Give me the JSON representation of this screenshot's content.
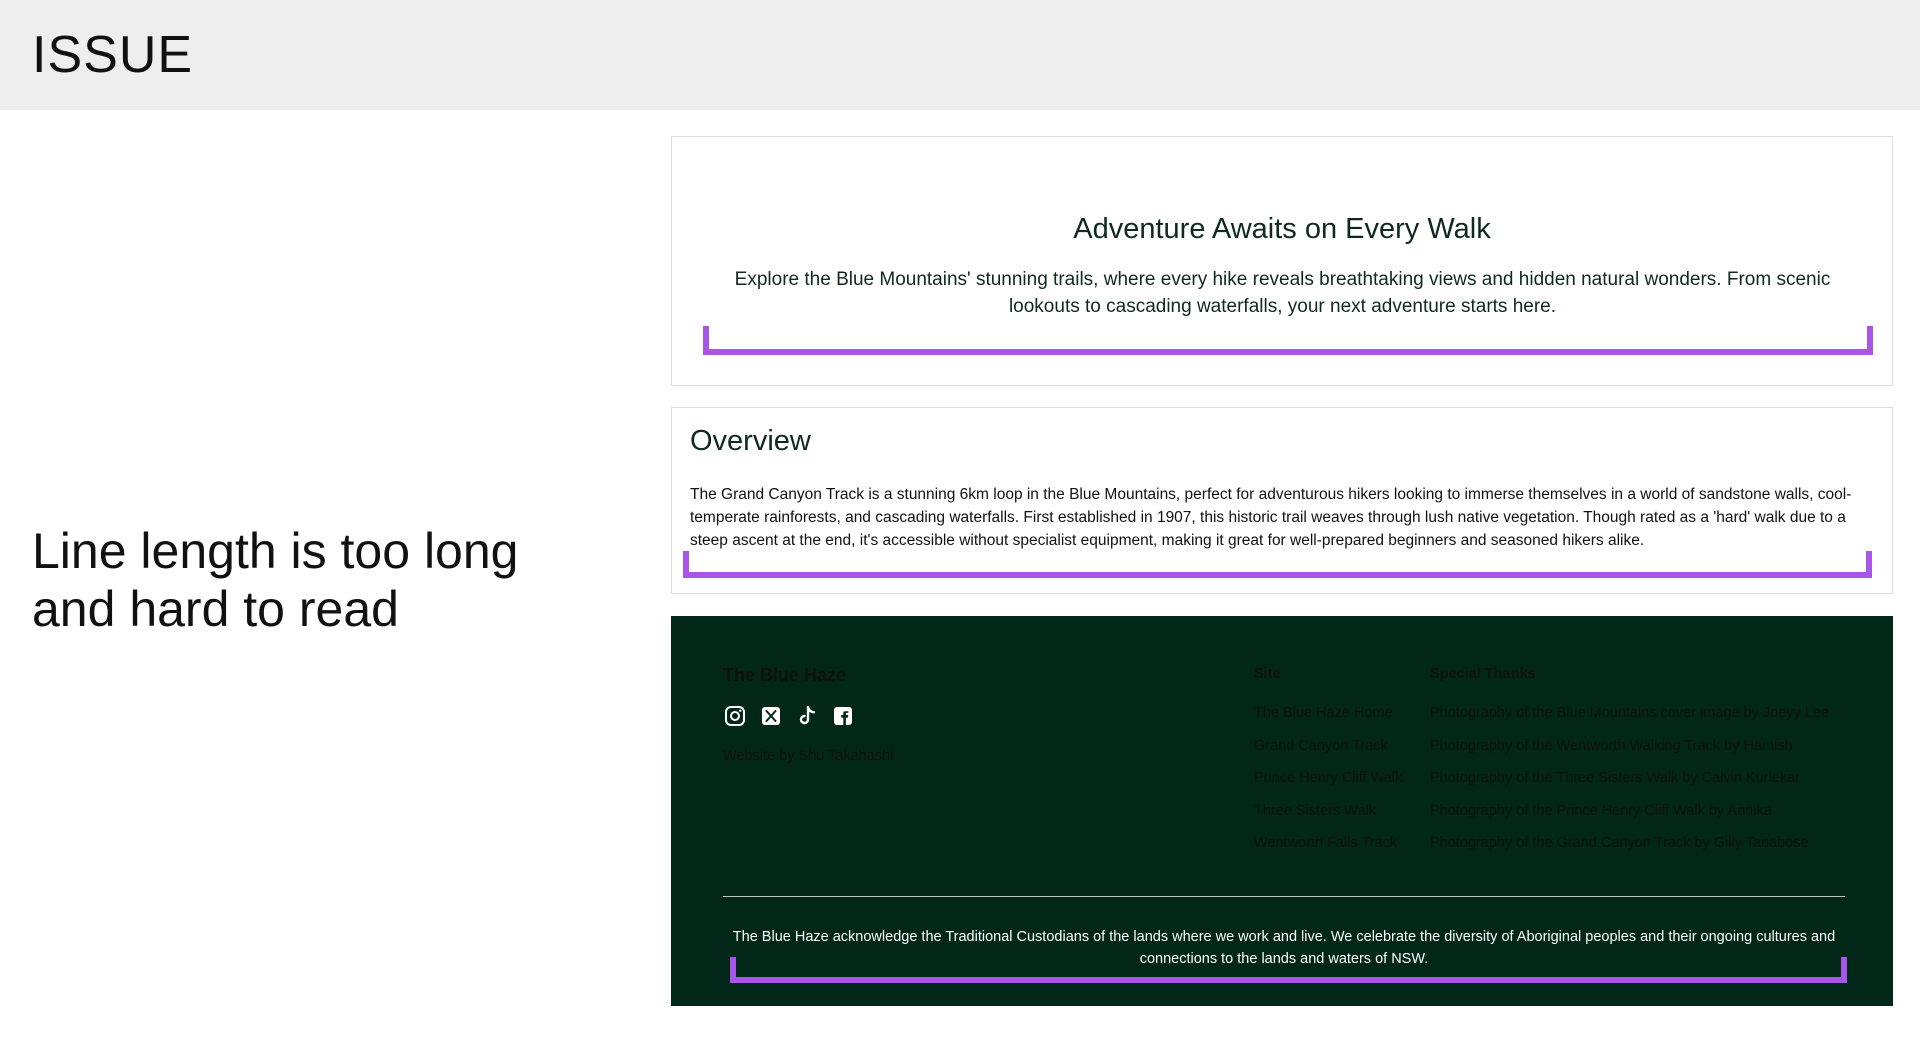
{
  "issue": {
    "title": "ISSUE",
    "note": "Line length is too long and hard to read"
  },
  "hero": {
    "heading": "Adventure Awaits on Every Walk",
    "text": "Explore the Blue Mountains' stunning trails, where every hike reveals breathtaking views and hidden natural wonders. From scenic lookouts to cascading waterfalls, your next adventure starts here."
  },
  "overview": {
    "heading": "Overview",
    "text": "The Grand Canyon Track is a stunning 6km loop in the Blue Mountains, perfect for adventurous hikers looking to immerse themselves in a world of sandstone walls, cool-temperate rainforests, and cascading waterfalls. First established in 1907, this historic trail weaves through lush native vegetation. Though rated as a 'hard' walk due to a steep ascent at the end, it's accessible without specialist equipment, making it great for well-prepared beginners and seasoned hikers alike."
  },
  "footer": {
    "brand": "The Blue Haze",
    "social_icons": [
      "instagram-icon",
      "x-twitter-icon",
      "tiktok-icon",
      "facebook-icon"
    ],
    "credit": "Website by Shu Takahashi",
    "site_title": "Site",
    "site_links": [
      "The Blue Haze Home",
      "Grand Canyon Track",
      "Prince Henry Cliff Walk",
      "Three Sisters Walk",
      "Wentworth Falls Track"
    ],
    "thanks_title": "Special Thanks",
    "thanks": [
      "Photography of the Blue Mountains cover image by Joeyy Lee",
      "Photography of the Wentworth Walking Track by Hamish",
      "Photography of the Three Sisters Walk by Calvin Kurlekar",
      "Photography of the Prince Henry Cliff Walk by Annika",
      "Photography of the Grand Canyon Track by Gilly Tanabose"
    ],
    "acknowledgement": "The Blue Haze acknowledge the Traditional Custodians of the lands where we work and live. We celebrate the diversity of Aboriginal peoples and their ongoing cultures and connections to the lands and waters of NSW."
  },
  "colors": {
    "footer_bg": "#012718",
    "heading_text": "#0f2a1d",
    "highlight_bracket": "#a855e8",
    "issue_bar": "#eeeeee"
  }
}
